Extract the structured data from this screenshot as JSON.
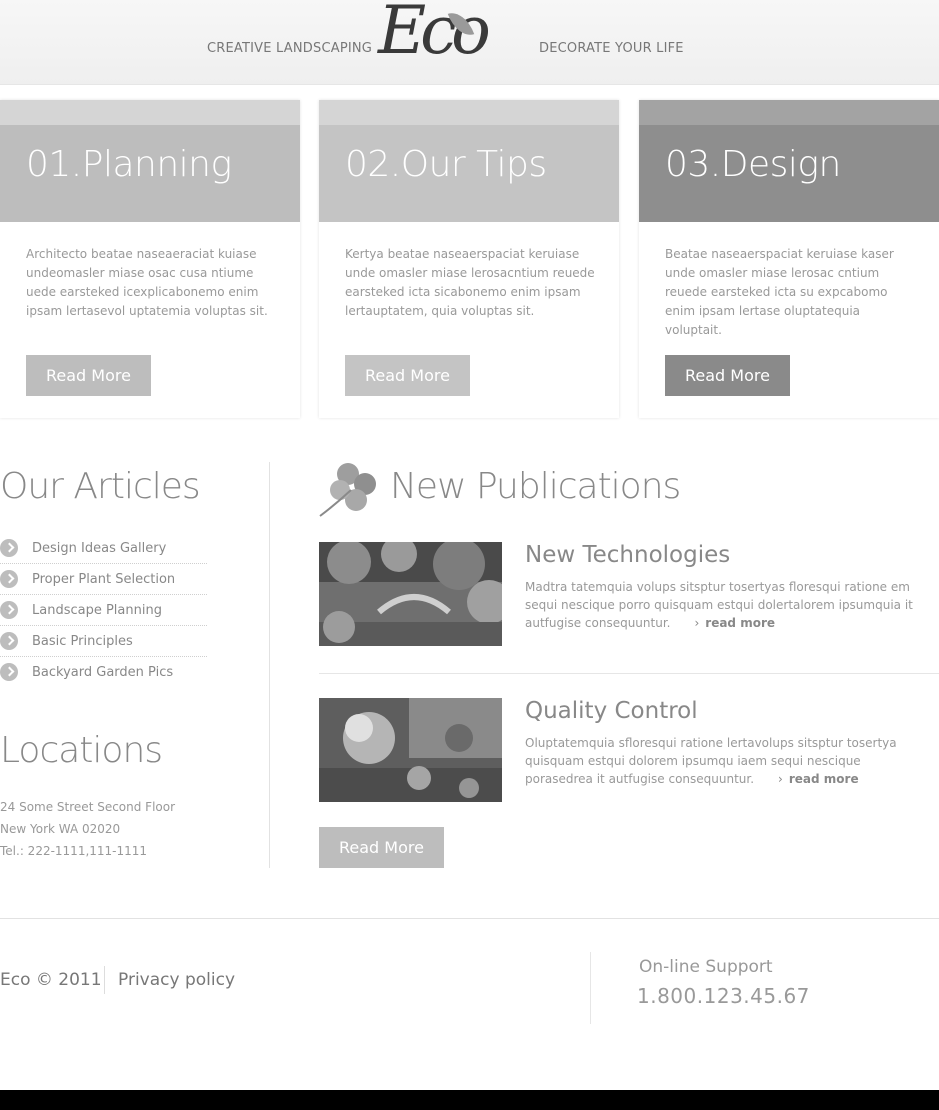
{
  "header": {
    "tagline_left": "CREATIVE LANDSCAPING",
    "tagline_right": "DECORATE YOUR LIFE",
    "logo_text": "Eco"
  },
  "cards": [
    {
      "title": "01.Planning",
      "text": "Architecto beatae naseaeraciat kuiase undeomasler miase osac cusa ntiume uede earsteked icexplicabonemo enim ipsam lertasevol uptatemia voluptas sit.",
      "button": "Read More",
      "color_top": "#d5d5d5",
      "color_head": "#bdbdbd",
      "color_button": "#bdbdbd"
    },
    {
      "title": "02.Our Tips",
      "text": "Kertya beatae naseaerspaciat keruiase unde omasler miase lerosacntium reuede earsteked icta sicabonemo enim ipsam lertauptatem, quia voluptas sit.",
      "button": "Read More",
      "color_top": "#d5d5d5",
      "color_head": "#c4c4c4",
      "color_button": "#c4c4c4"
    },
    {
      "title": "03.Design",
      "text": "Beatae naseaerspaciat keruiase kaser unde omasler miase lerosac cntium reuede earsteked icta su expcabomo enim ipsam lertase oluptatequia voluptait.",
      "button": "Read More",
      "color_top": "#a3a3a3",
      "color_head": "#8e8e8e",
      "color_button": "#8a8a8a"
    }
  ],
  "articles": {
    "title": "Our Articles",
    "items": [
      "Design Ideas Gallery",
      "Proper Plant Selection",
      "Landscape Planning",
      "Basic Principles",
      "Backyard Garden Pics"
    ]
  },
  "locations": {
    "title": "Locations",
    "line1": "24 Some Street Second Floor",
    "line2": "New York WA 02020",
    "line3": "Tel.: 222-1111,111-1111"
  },
  "publications": {
    "title": "New Publications",
    "items": [
      {
        "title": "New Technologies",
        "text": "Madtra tatemquia volups sitsptur tosertyas floresqui ratione em sequi nescique porro quisquam estqui dolertalorem ipsumquia it autfugise consequuntur.",
        "link": "read more"
      },
      {
        "title": "Quality Control",
        "text": "Oluptatemquia sfloresqui ratione lertavolups sitsptur tosertya quisquam estqui dolorem ipsumqu iaem sequi nescique porasedrea it autfugise consequuntur.",
        "link": "read more"
      }
    ],
    "button": "Read More"
  },
  "footer": {
    "copyright": "Eco © 2011",
    "privacy": "Privacy policy",
    "support_label": "On-line Support",
    "support_phone": "1.800.123.45.67"
  }
}
